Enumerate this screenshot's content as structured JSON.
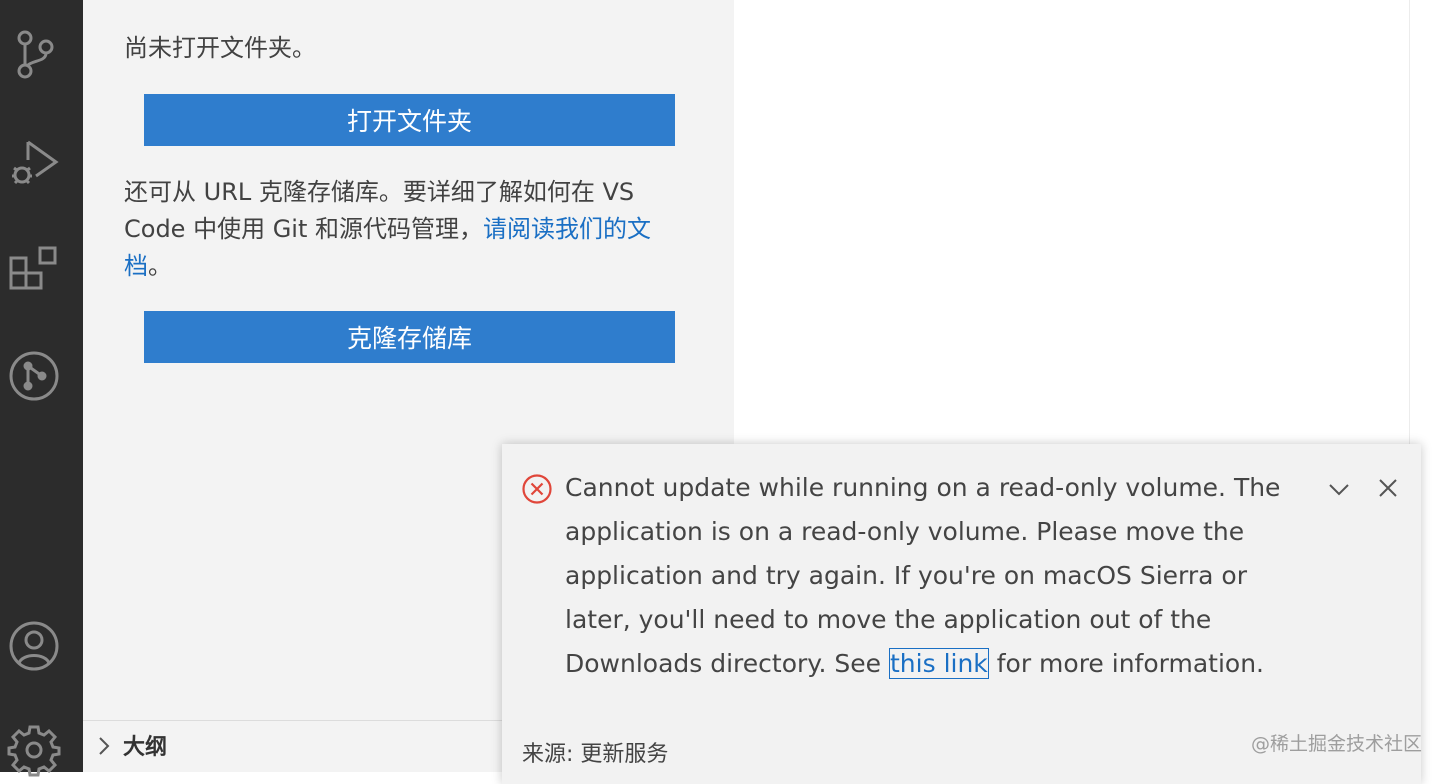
{
  "activity_bar": {
    "icons": [
      "source-control-icon",
      "run-debug-icon",
      "extensions-icon",
      "git-graph-icon",
      "account-icon",
      "manage-gear-icon"
    ]
  },
  "sidebar": {
    "empty_message": "尚未打开文件夹。",
    "open_folder_label": "打开文件夹",
    "clone_message_prefix": "还可从 URL 克隆存储库。要详细了解如何在 VS Code 中使用 Git 和源代码管理，",
    "clone_message_link": "请阅读我们的文档",
    "clone_message_suffix": "。",
    "clone_repo_label": "克隆存储库",
    "outline_title": "大纲"
  },
  "notification": {
    "severity": "error",
    "message_text": "Cannot update while running on a read-only volume. The application is on a read-only volume. Please move the application and try again. If you're on macOS Sierra or later, you'll need to move the application out of the Downloads directory. See ",
    "link_text": "this link",
    "message_suffix": " for more information.",
    "source": "来源: 更新服务"
  },
  "watermark": "@稀土掘金技术社区",
  "colors": {
    "activity_bar": "#2c2c2c",
    "sidebar": "#f3f3f3",
    "button": "#2f7dcd",
    "link": "#1a6fc4",
    "error": "#e0463a"
  }
}
